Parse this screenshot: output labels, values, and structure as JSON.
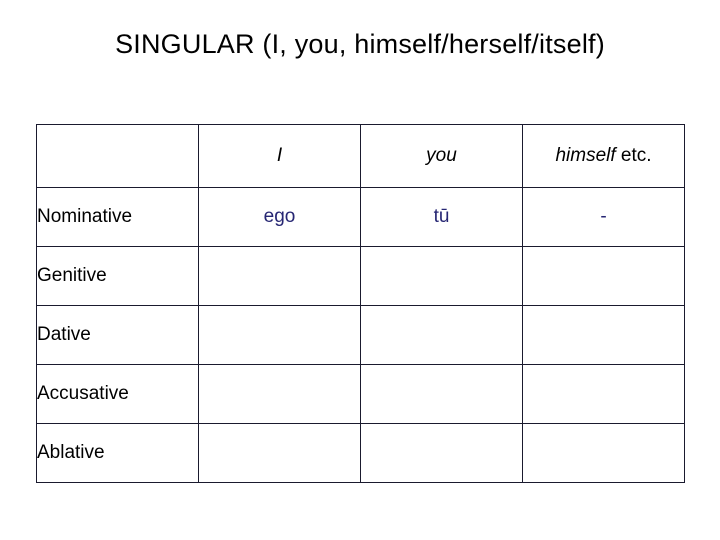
{
  "slide": {
    "title": "SINGULAR (I, you, himself/herself/itself)"
  },
  "table": {
    "headers": [
      "",
      "I",
      "you",
      "himself",
      "etc."
    ],
    "header_cells": {
      "corner": "",
      "col1": "I",
      "col2": "you",
      "col3_italic": "himself",
      "col3_normal": " etc."
    },
    "rows": [
      {
        "case": "Nominative",
        "c1": "ego",
        "c2": "tū",
        "c3": "-"
      },
      {
        "case": "Genitive",
        "c1": "",
        "c2": "",
        "c3": ""
      },
      {
        "case": "Dative",
        "c1": "",
        "c2": "",
        "c3": ""
      },
      {
        "case": "Accusative",
        "c1": "",
        "c2": "",
        "c3": ""
      },
      {
        "case": "Ablative",
        "c1": "",
        "c2": "",
        "c3": ""
      }
    ]
  },
  "colors": {
    "text": "#000000",
    "form_text": "#262673",
    "border": "#1a1a2e",
    "background": "#ffffff"
  }
}
